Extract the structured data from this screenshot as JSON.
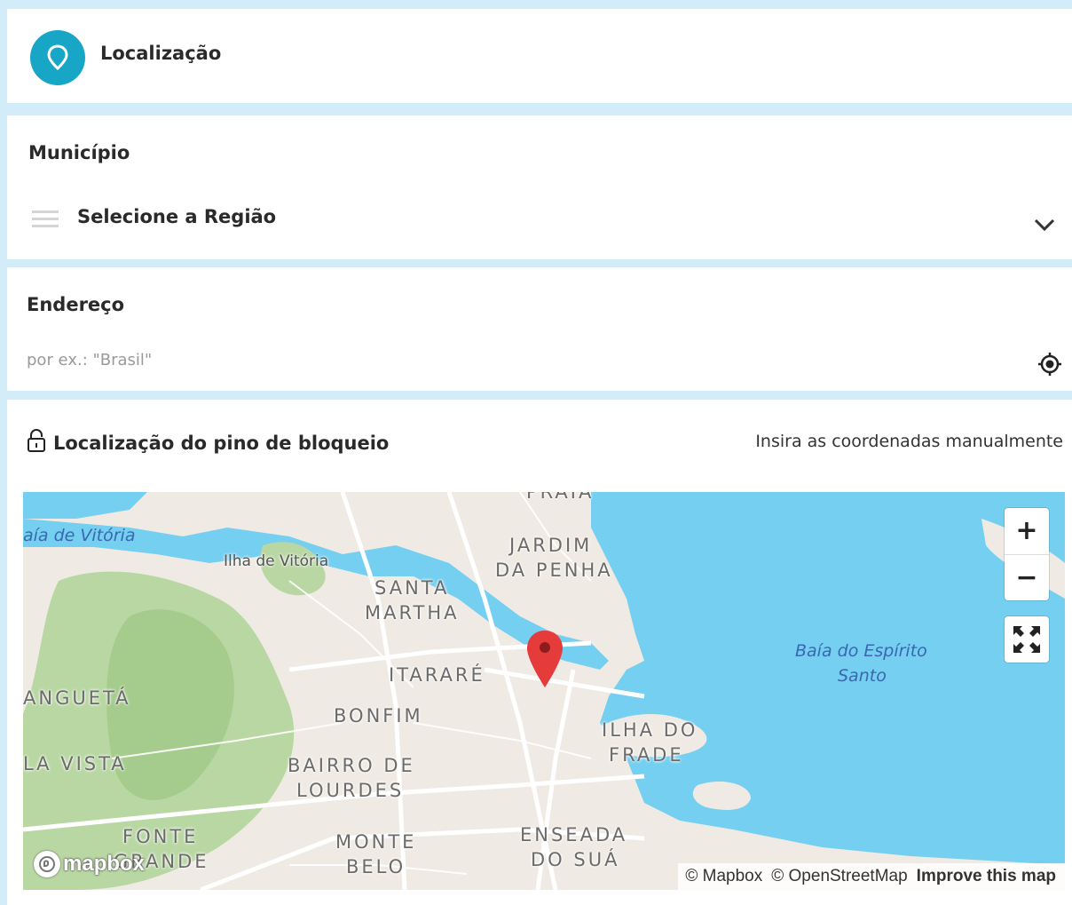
{
  "header": {
    "title": "Localização",
    "icon": "map-pin-icon",
    "accent_color": "#17a6c6"
  },
  "municipio": {
    "label": "Município",
    "select_value": "Selecione a Região"
  },
  "endereco": {
    "label": "Endereço",
    "placeholder": "por ex.: \"Brasil\""
  },
  "pin": {
    "title": "Localização do pino de bloqueio",
    "manual_link": "Insira as coordenadas manualmente"
  },
  "map": {
    "zoom_in": "+",
    "zoom_out": "−",
    "logo": "mapbox",
    "attribution": {
      "mapbox": "© Mapbox",
      "osm": "© OpenStreetMap",
      "improve": "Improve this map"
    },
    "places": {
      "praia": "PRAIA",
      "jardim_da_penha_1": "JARDIM",
      "jardim_da_penha_2": "DA PENHA",
      "santa_martha_1": "SANTA",
      "santa_martha_2": "MARTHA",
      "itarare": "ITARARÉ",
      "bonfim": "BONFIM",
      "bairro_de_lourdes_1": "BAIRRO DE",
      "bairro_de_lourdes_2": "LOURDES",
      "ilha_do_frade_1": "ILHA DO",
      "ilha_do_frade_2": "FRADE",
      "angueta": "ANGUETÁ",
      "la_vista": "LA VISTA",
      "fonte_grande_1": "FONTE",
      "fonte_grande_2": "GRANDE",
      "monte_belo_1": "MONTE",
      "monte_belo_2": "BELO",
      "enseada_do_sua_1": "ENSEADA",
      "enseada_do_sua_2": "DO SUÁ",
      "ilha_de_vitoria": "Ilha de Vitória",
      "baia_de_vitoria": "aía de Vitória",
      "baia_espirito_santo_1": "Baía do Espírito",
      "baia_espirito_santo_2": "Santo"
    }
  }
}
